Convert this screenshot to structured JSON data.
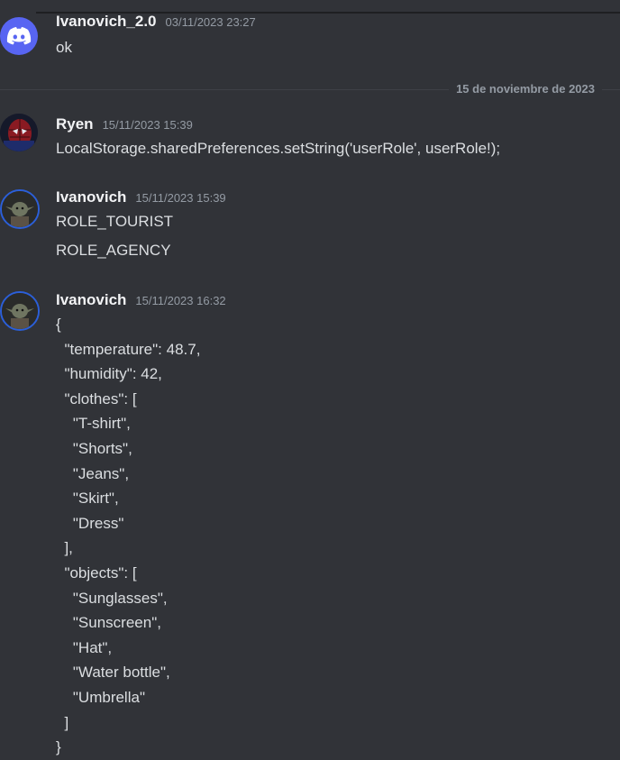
{
  "date_divider": "15 de noviembre de 2023",
  "messages": [
    {
      "author": "Ivanovich_2.0",
      "timestamp": "03/11/2023 23:27",
      "avatar": "discord-logo-icon",
      "lines": [
        "ok"
      ]
    },
    {
      "author": "Ryen",
      "timestamp": "15/11/2023 15:39",
      "avatar": "spiderman-avatar-icon",
      "lines": [
        "LocalStorage.sharedPreferences.setString('userRole', userRole!);"
      ]
    },
    {
      "author": "Ivanovich",
      "timestamp": "15/11/2023 15:39",
      "avatar": "yoda-avatar-icon",
      "lines": [
        "ROLE_TOURIST",
        "ROLE_AGENCY"
      ]
    },
    {
      "author": "Ivanovich",
      "timestamp": "15/11/2023 16:32",
      "avatar": "yoda-avatar-icon",
      "lines": [
        "{",
        "  \"temperature\": 48.7,",
        "  \"humidity\": 42,",
        "  \"clothes\": [",
        "    \"T-shirt\",",
        "    \"Shorts\",",
        "    \"Jeans\",",
        "    \"Skirt\",",
        "    \"Dress\"",
        "  ],",
        "  \"objects\": [",
        "    \"Sunglasses\",",
        "    \"Sunscreen\",",
        "    \"Hat\",",
        "    \"Water bottle\",",
        "    \"Umbrella\"",
        "  ]",
        "}"
      ]
    }
  ],
  "colors": {
    "background": "#313338",
    "discord_blurple": "#5865f2",
    "timestamp": "#949ba4"
  }
}
